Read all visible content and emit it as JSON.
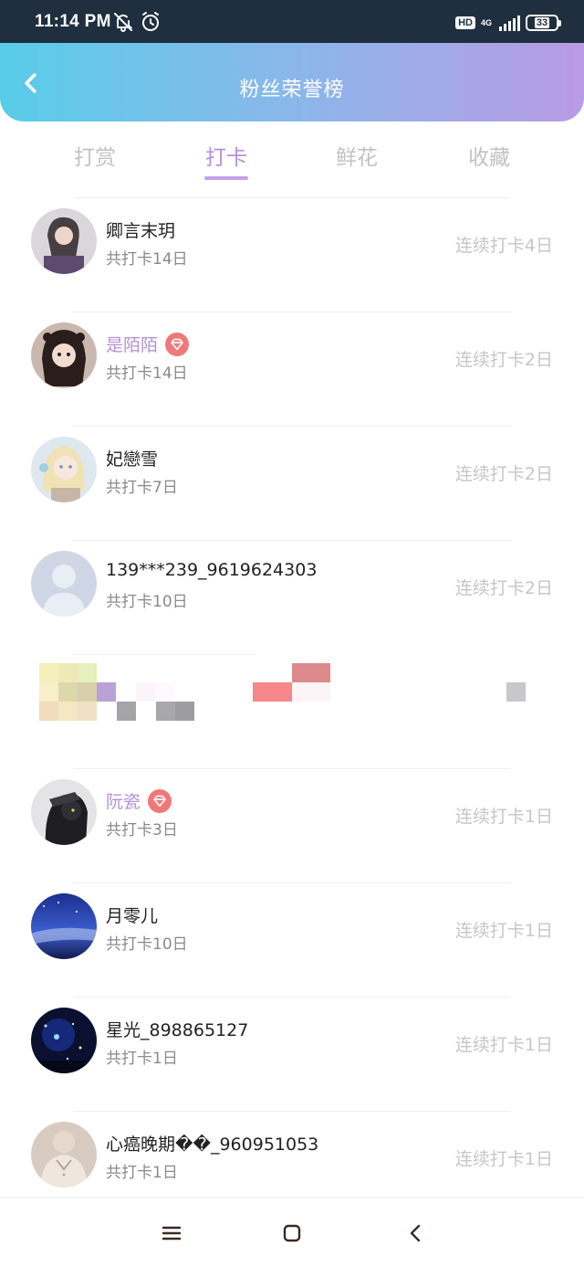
{
  "status_bar": {
    "time": "11:14 PM",
    "left_icons": [
      "bell-off-icon",
      "alarm-icon"
    ],
    "hd": "HD",
    "network": "4G",
    "battery": "33"
  },
  "header": {
    "title": "粉丝荣誉榜",
    "back_icon": "chevron-left-icon"
  },
  "tabs": [
    {
      "label": "打赏",
      "active": false
    },
    {
      "label": "打卡",
      "active": true
    },
    {
      "label": "鲜花",
      "active": false
    },
    {
      "label": "收藏",
      "active": false
    }
  ],
  "rows": [
    {
      "name": "卿言末玥",
      "total": "共打卡14日",
      "streak": "连续打卡4日",
      "vip": false
    },
    {
      "name": "是陌陌",
      "total": "共打卡14日",
      "streak": "连续打卡2日",
      "vip": true
    },
    {
      "name": "妃戀雪",
      "total": "共打卡7日",
      "streak": "连续打卡2日",
      "vip": false
    },
    {
      "name": "139***239_9619624303",
      "total": "共打卡10日",
      "streak": "连续打卡2日",
      "vip": false
    },
    {
      "name": "",
      "total": "",
      "streak": "",
      "vip": false,
      "pixelated": true
    },
    {
      "name": "阮瓷",
      "total": "共打卡3日",
      "streak": "连续打卡1日",
      "vip": true
    },
    {
      "name": "月零儿",
      "total": "共打卡10日",
      "streak": "连续打卡1日",
      "vip": false
    },
    {
      "name": "星光_898865127",
      "total": "共打卡1日",
      "streak": "连续打卡1日",
      "vip": false
    },
    {
      "name": "心癌晚期��_960951053",
      "total": "共打卡1日",
      "streak": "连续打卡1日",
      "vip": false
    }
  ],
  "colors": {
    "header_gradient": [
      "#58cde9",
      "#8bb7ea",
      "#b99be5"
    ],
    "active_tab": "#b68fd8",
    "vip_name": "#b591d7",
    "vip_badge": "#f07879"
  },
  "nav_bar": {
    "icons": [
      "menu-icon",
      "home-icon",
      "back-icon"
    ]
  }
}
